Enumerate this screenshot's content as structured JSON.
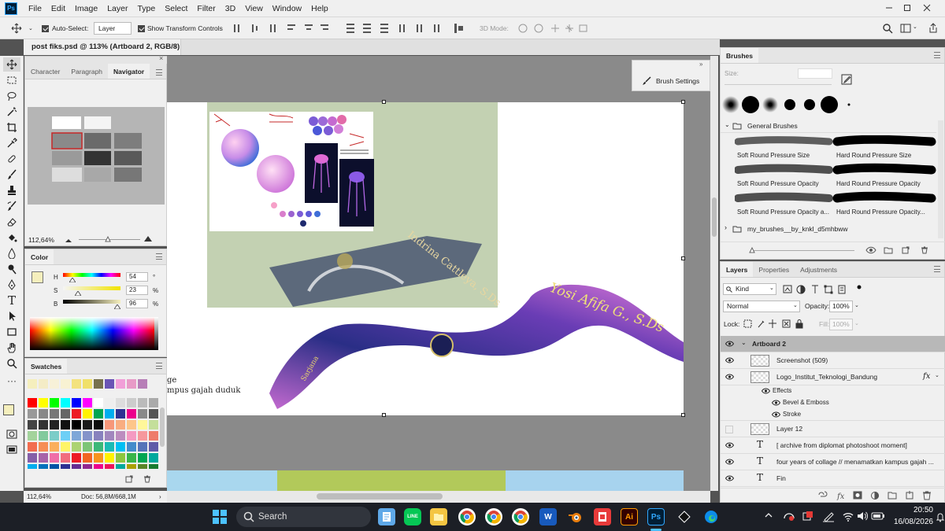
{
  "menubar": {
    "app_icon": "Ps",
    "items": [
      "File",
      "Edit",
      "Image",
      "Layer",
      "Type",
      "Select",
      "Filter",
      "3D",
      "View",
      "Window",
      "Help"
    ]
  },
  "options": {
    "auto_select_label": "Auto-Select:",
    "auto_select_value": "Layer",
    "show_transform_label": "Show Transform Controls",
    "mode_3d_label": "3D Mode:"
  },
  "document": {
    "tab_title": "post fiks.psd @ 113% (Artboard 2, RGB/8) *"
  },
  "left_panel": {
    "tabs": [
      "Character",
      "Paragraph",
      "Navigator"
    ],
    "navigator_zoom": "112,64%",
    "color_tab": "Color",
    "color": {
      "h_label": "H",
      "h": "54",
      "h_unit": "°",
      "s_label": "S",
      "s": "23",
      "s_unit": "%",
      "b_label": "B",
      "b": "96",
      "b_unit": "%",
      "fg": "#f5efbd"
    },
    "swatches_tab": "Swatches"
  },
  "status": {
    "zoom": "112,64%",
    "doc": "Doc: 56,8M/668,1M"
  },
  "canvas": {
    "text_line1": "ge",
    "text_line2": "mpus gajah duduk",
    "sash1_text": "Indrina Cattleya, S.Ds",
    "sash2_text": "Yosi Afifa G., S.Ds"
  },
  "brush_settings": {
    "label": "Brush Settings"
  },
  "brushes": {
    "tab": "Brushes",
    "size_label": "Size:",
    "group": "General Brushes",
    "items": [
      "Soft Round Pressure Size",
      "Hard Round Pressure Size",
      "Soft Round Pressure Opacity",
      "Hard Round Pressure Opacity",
      "Soft Round Pressure Opacity a...",
      "Hard Round Pressure Opacity..."
    ],
    "group2": "my_brushes__by_knkl_d5mhbww"
  },
  "layers": {
    "tabs": [
      "Layers",
      "Properties",
      "Adjustments"
    ],
    "kind": "Kind",
    "blend": "Normal",
    "opacity_label": "Opacity:",
    "opacity": "100%",
    "lock_label": "Lock:",
    "fill_label": "Fill:",
    "fill": "100%",
    "group": "Artboard 2",
    "rows": [
      "Screenshot (509)",
      "Logo_Institut_Teknologi_Bandung",
      "Effects",
      "Bevel & Emboss",
      "Stroke",
      "Layer 12",
      "[ archive from  diplomat photoshoot moment]",
      "four years of collage // menamatkan kampus gajah ...",
      "Fin"
    ],
    "fx": "fx"
  },
  "taskbar": {
    "search": "Search",
    "time": "20:50",
    "date": "16/08/2026"
  }
}
